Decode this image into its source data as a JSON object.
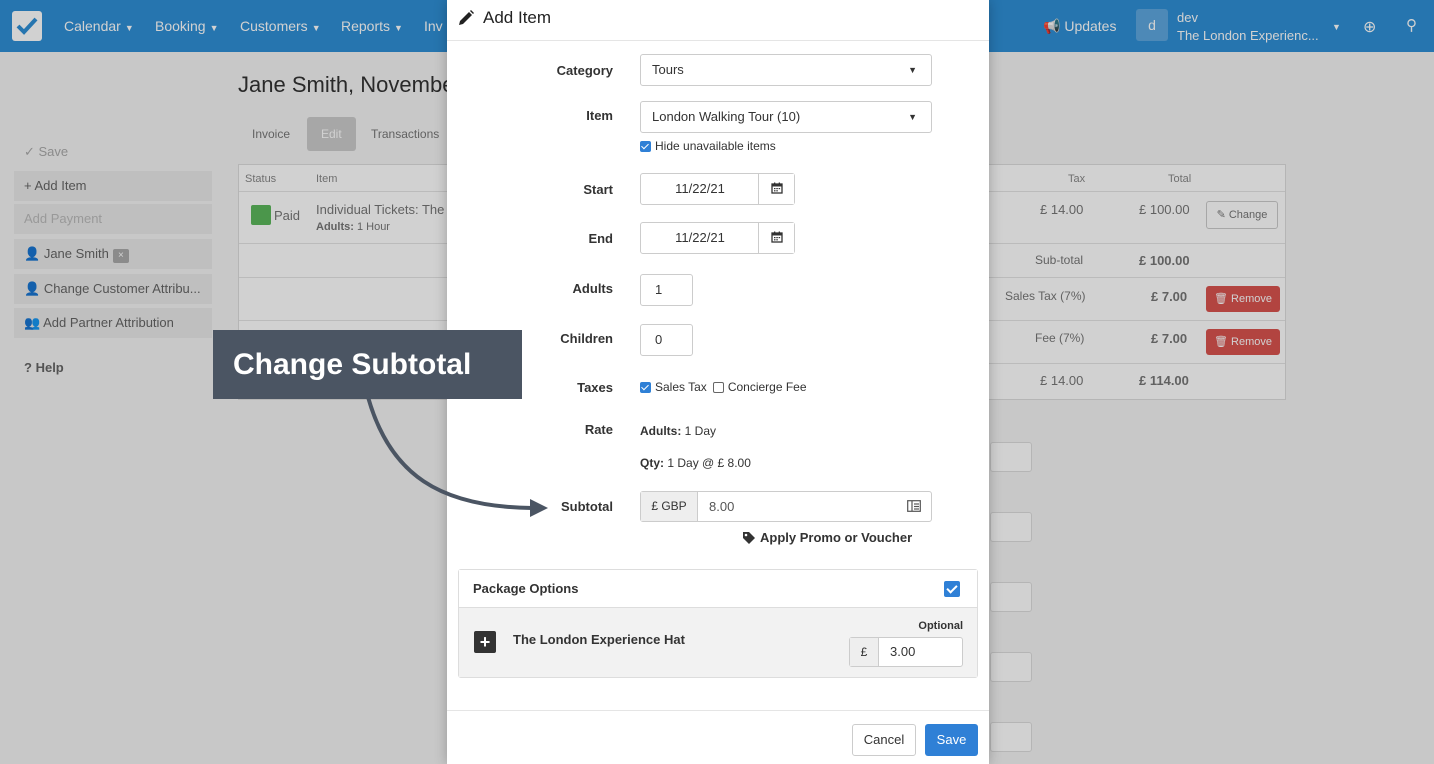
{
  "topnav": {
    "items": [
      {
        "label": "Calendar"
      },
      {
        "label": "Booking"
      },
      {
        "label": "Customers"
      },
      {
        "label": "Reports"
      },
      {
        "label": "Inv"
      }
    ],
    "updates_label": "Updates",
    "user_initial": "d",
    "user_name": "dev",
    "user_org": "The London Experienc..."
  },
  "background": {
    "page_title": "Jane Smith, November",
    "tabs": [
      "Invoice",
      "Edit",
      "Transactions"
    ],
    "sidebar": [
      {
        "label": "✓ Save"
      },
      {
        "label": "+ Add Item"
      },
      {
        "label": "Add Payment"
      },
      {
        "label": "Jane Smith"
      },
      {
        "label": "Change Customer Attribu..."
      },
      {
        "label": "Add Partner Attribution"
      },
      {
        "label": "Help"
      }
    ],
    "table": {
      "headers": {
        "status": "Status",
        "item": "Item",
        "tax": "Tax",
        "total": "Total"
      },
      "row": {
        "status": "Paid",
        "item": "Individual Tickets: The",
        "detail_label": "Adults:",
        "detail_value": "1 Hour",
        "tax": "£ 14.00",
        "total": "£ 100.00",
        "action": "Change"
      },
      "subtotal": {
        "label": "Sub-total",
        "value": "£ 100.00"
      },
      "sales_tax": {
        "label": "Sales Tax (7%)",
        "value": "£ 7.00",
        "action": "Remove"
      },
      "fee": {
        "label": "Fee (7%)",
        "value": "£ 7.00",
        "action": "Remove"
      },
      "grand": {
        "tax": "£ 14.00",
        "total": "£ 114.00"
      }
    }
  },
  "modal": {
    "title": "Add Item",
    "category": {
      "label": "Category",
      "value": "Tours"
    },
    "item": {
      "label": "Item",
      "value": "London Walking Tour (10)"
    },
    "hide_unavailable": {
      "label": "Hide unavailable items",
      "checked": true
    },
    "start": {
      "label": "Start",
      "value": "11/22/21"
    },
    "end": {
      "label": "End",
      "value": "11/22/21"
    },
    "adults": {
      "label": "Adults",
      "value": "1"
    },
    "children": {
      "label": "Children",
      "value": "0"
    },
    "taxes": {
      "label": "Taxes",
      "options": [
        {
          "label": "Sales Tax",
          "checked": true
        },
        {
          "label": "Concierge Fee",
          "checked": false
        }
      ]
    },
    "rate": {
      "label": "Rate",
      "line1_label": "Adults:",
      "line1_value": "1 Day",
      "line2_label": "Qty:",
      "line2_value": "1 Day @ £ 8.00"
    },
    "subtotal": {
      "label": "Subtotal",
      "currency": "£ GBP",
      "value": "8.00"
    },
    "promo_label": "Apply Promo or Voucher",
    "package": {
      "title": "Package Options",
      "checked": true,
      "item_name": "The London Experience Hat",
      "optional_label": "Optional",
      "currency": "£",
      "price": "3.00"
    },
    "cancel_label": "Cancel",
    "save_label": "Save"
  },
  "callout": {
    "text": "Change Subtotal"
  },
  "colors": {
    "primary": "#2f80d6",
    "nav": "#2f8fd6",
    "callout": "#4b5563",
    "danger": "#d9534f",
    "success": "#5cb85c"
  }
}
